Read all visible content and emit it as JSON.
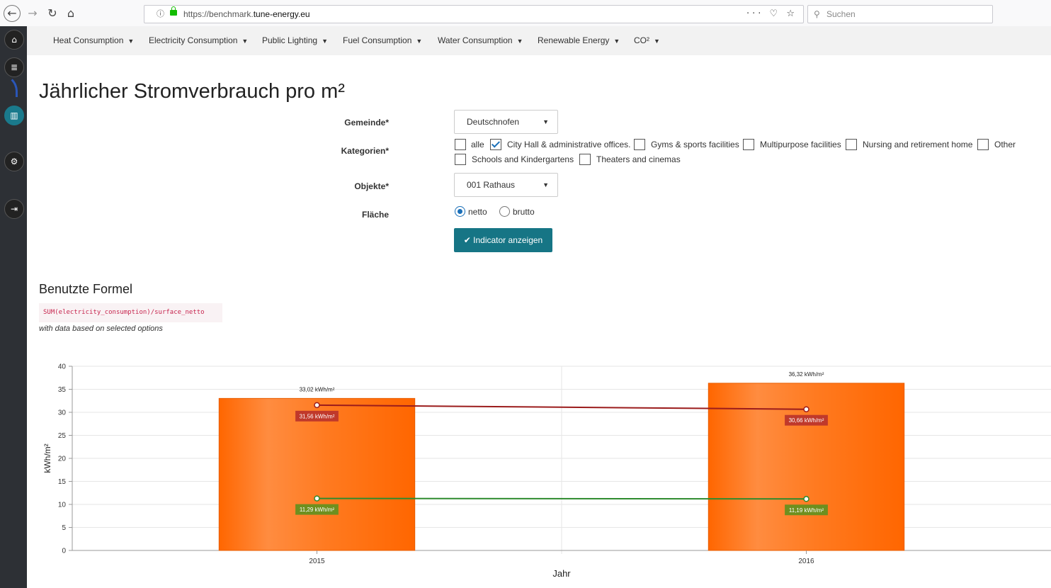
{
  "browser": {
    "url_prefix": "https://benchmark.",
    "url_domain": "tune-energy.eu",
    "url_tools": "··· ♡ ☆",
    "search_placeholder": "Suchen"
  },
  "menu": [
    {
      "label": "Heat Consumption"
    },
    {
      "label": "Electricity Consumption"
    },
    {
      "label": "Public Lighting"
    },
    {
      "label": "Fuel Consumption"
    },
    {
      "label": "Water Consumption"
    },
    {
      "label": "Renewable Energy"
    },
    {
      "label": "CO²"
    }
  ],
  "page": {
    "title": "Jährlicher Stromverbrauch pro m²"
  },
  "form": {
    "gemeinde_label": "Gemeinde*",
    "gemeinde_value": "Deutschnofen",
    "kategorien_label": "Kategorien*",
    "categories": [
      {
        "label": "alle",
        "checked": false
      },
      {
        "label": "City Hall & administrative offices.",
        "checked": true
      },
      {
        "label": "Gyms & sports facilities",
        "checked": false
      },
      {
        "label": "Multipurpose facilities",
        "checked": false
      },
      {
        "label": "Nursing and retirement home",
        "checked": false
      },
      {
        "label": "Other",
        "checked": false
      },
      {
        "label": "Schools and Kindergartens",
        "checked": false
      },
      {
        "label": "Theaters and cinemas",
        "checked": false
      }
    ],
    "objekte_label": "Objekte*",
    "objekte_value": "001 Rathaus",
    "flaeche_label": "Fläche",
    "flaeche_options": [
      {
        "label": "netto",
        "selected": true
      },
      {
        "label": "brutto",
        "selected": false
      }
    ],
    "submit_label": "Indicator anzeigen"
  },
  "formula": {
    "heading": "Benutzte Formel",
    "code": "SUM(electricity_consumption)/surface_netto",
    "note": "with data based on selected options"
  },
  "chart_data": {
    "type": "bar",
    "categories": [
      "2015",
      "2016"
    ],
    "xlabel": "Jahr",
    "ylabel": "kWh/m²",
    "ylim": [
      0,
      40
    ],
    "yticks": [
      0,
      5,
      10,
      15,
      20,
      25,
      30,
      35,
      40
    ],
    "grid": true,
    "series": [
      {
        "type": "bar",
        "values": [
          33.02
        ],
        "labels": [
          "33,02 kWh/m²"
        ],
        "color": "#ff6a00"
      },
      {
        "type": "bar",
        "values": [
          36.32
        ],
        "labels": [
          "36,32 kWh/m²"
        ],
        "color": "#ff6a00"
      },
      {
        "type": "line",
        "values": [
          31.56,
          30.66
        ],
        "labels": [
          "31,56 kWh/m²",
          "30,66 kWh/m²"
        ],
        "color": "#9b1c1c",
        "label_bg": "#c0392b"
      },
      {
        "type": "line",
        "values": [
          11.29,
          11.19
        ],
        "labels": [
          "11,29 kWh/m²",
          "11,19 kWh/m²"
        ],
        "color": "#2e8b2e",
        "label_bg": "#6e8f1f"
      }
    ]
  }
}
